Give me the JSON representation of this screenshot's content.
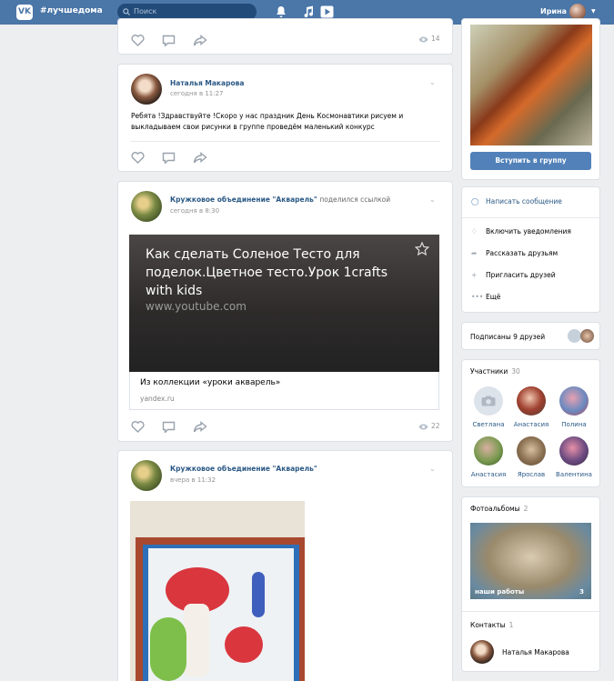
{
  "topbar": {
    "logo": "VK",
    "site": "#лучшедома",
    "search_placeholder": "Поиск",
    "user_name": "Ирина"
  },
  "post0": {
    "views": "14"
  },
  "post1": {
    "author": "Наталья Макарова",
    "time": "сегодня в 11:27",
    "text": "Ребята !Здравствуйте !Скоро у нас праздник День Космонавтики рисуем и выкладываем свои рисунки в группе проведём маленький конкурс"
  },
  "post2": {
    "author": "Кружковое объединение \"Акварель\"",
    "shared": "поделился ссылкой",
    "time": "сегодня в 8:30",
    "link_title": "Как сделать Соленое Тесто для поделок.Цветное тесто.Урок 1crafts with kids",
    "link_url": "www.youtube.com",
    "caption": "Из коллекции «уроки акварель»",
    "domain": "yandex.ru",
    "views": "22"
  },
  "post3": {
    "author": "Кружковое объединение \"Акварель\"",
    "time": "вчера в 11:32"
  },
  "sidebar": {
    "join_button": "Вступить в группу",
    "menu": [
      "Написать сообщение",
      "Включить уведомления",
      "Рассказать друзьям",
      "Пригласить друзей",
      "Ещё"
    ],
    "friends_subscribed": "Подписаны 9 друзей",
    "members_title": "Участники",
    "members_count": "30",
    "members": [
      "Светлана",
      "Анастасия",
      "Полина",
      "Анастасия",
      "Ярослав",
      "Валентина"
    ],
    "albums_title": "Фотоальбомы",
    "albums_count": "2",
    "album_name": "наши работы",
    "album_photos": "3",
    "contacts_title": "Контакты",
    "contacts_count": "1",
    "contact_name": "Наталья Макарова"
  }
}
